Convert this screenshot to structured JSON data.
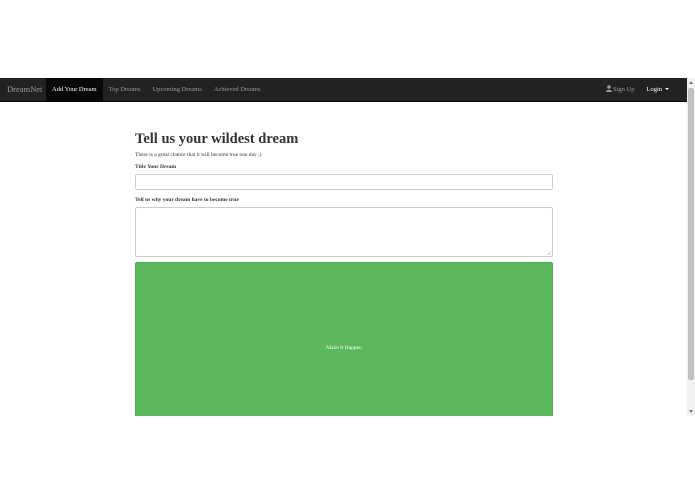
{
  "navbar": {
    "brand": "DreamNet",
    "items": [
      {
        "label": "Add Your Dream",
        "active": true
      },
      {
        "label": "Top Dreams",
        "active": false
      },
      {
        "label": "Upcoming Dreams",
        "active": false
      },
      {
        "label": "Achieved Dreams",
        "active": false
      }
    ],
    "signup_label": "Sign Up",
    "login_label": "Login",
    "icons": {
      "signup": "user-icon",
      "login": "caret-down-icon"
    }
  },
  "form": {
    "heading": "Tell us your wildest dream",
    "subheading": "There is a great chance that it will become true one day ;)",
    "title_label": "Title Your Dream",
    "title_value": "",
    "reason_label": "Tell us why your dream have to become true",
    "reason_value": "",
    "submit_label": "Make It Happen"
  },
  "colors": {
    "navbar": "#222222",
    "active_nav": "#080808",
    "success": "#5cb85c"
  }
}
